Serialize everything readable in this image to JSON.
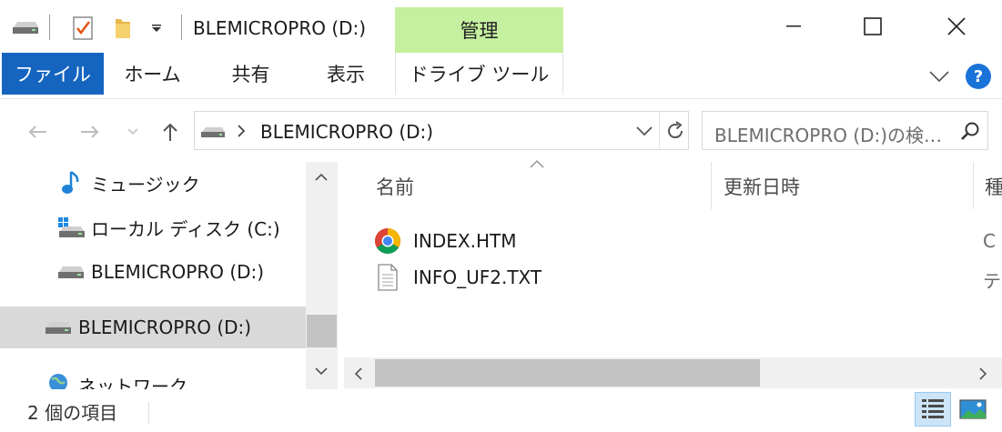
{
  "window": {
    "title": "BLEMICROPRO (D:)",
    "contextual_tab": "管理"
  },
  "quick_access": [
    "drive-icon",
    "properties-check-icon",
    "folder-icon",
    "customize-dropdown-icon"
  ],
  "window_controls": [
    "minimize-icon",
    "maximize-icon",
    "close-icon"
  ],
  "ribbon": {
    "tabs": [
      {
        "label": "ファイル",
        "selected": true
      },
      {
        "label": "ホーム"
      },
      {
        "label": "共有"
      },
      {
        "label": "表示"
      },
      {
        "label": "ドライブ ツール"
      }
    ],
    "help": "?"
  },
  "address": {
    "path": "BLEMICROPRO (D:)",
    "search_placeholder": "BLEMICROPRO (D:)の検…"
  },
  "nav_pane": {
    "items": [
      {
        "label": "ミュージック",
        "icon": "music-note-icon"
      },
      {
        "label": "ローカル ディスク (C:)",
        "icon": "windows-drive-icon"
      },
      {
        "label": "BLEMICROPRO (D:)",
        "icon": "drive-icon"
      },
      {
        "label": "BLEMICROPRO (D:)",
        "icon": "drive-icon",
        "selected": true
      },
      {
        "label": "ネットワーク",
        "icon": "network-icon"
      }
    ]
  },
  "content": {
    "columns": [
      "名前",
      "更新日時",
      "種"
    ],
    "files": [
      {
        "name": "INDEX.HTM",
        "icon": "chrome-icon",
        "type_cut": "C"
      },
      {
        "name": "INFO_UF2.TXT",
        "icon": "text-file-icon",
        "type_cut": "テ"
      }
    ]
  },
  "status_bar": {
    "item_count": "2 個の項目"
  },
  "colors": {
    "file_tab": "#1565c0",
    "manage_tab": "#c5f0a0",
    "selection": "#d9d9d9",
    "help": "#1a73d9"
  }
}
